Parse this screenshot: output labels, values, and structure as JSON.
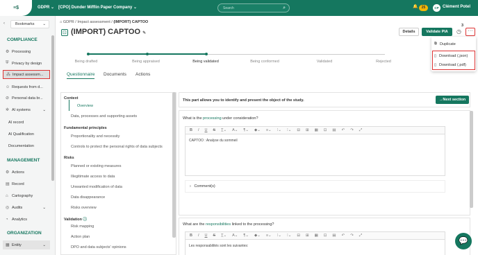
{
  "topbar": {
    "logo": "≡$",
    "app": "GDPR",
    "org": "[CPO] Dunder Mifflin Paper Company",
    "search_placeholder": "Search",
    "badge": "25",
    "avatar": "CP",
    "user": "Clément Potel"
  },
  "sidebar": {
    "bookmarks": "Bookmarks",
    "compliance": "COMPLIANCE",
    "items": [
      "Processing",
      "Privacy by design",
      "Impact assessm...",
      "Requests from d...",
      "Personal data br...",
      "AI systems",
      "AI record",
      "AI Qualification",
      "Documentation"
    ],
    "management": "MANAGEMENT",
    "mgmt_items": [
      "Actions",
      "Record",
      "Cartography",
      "Audits",
      "Analytics"
    ],
    "organization": "ORGANIZATION",
    "org_items": [
      "Entity"
    ]
  },
  "breadcrumb": {
    "home": "GDPR",
    "mid": "Impact assessment",
    "current": "(IMPORT) CAPTOO"
  },
  "title": "(IMPORT) CAPTOO",
  "buttons": {
    "details": "Details",
    "validate": "Validate PIA",
    "more": "···",
    "annotation": "3"
  },
  "dropdown": {
    "duplicate": "Duplicate",
    "json": "Download (.json)",
    "pdf": "Download (.pdf)"
  },
  "steps": [
    "Being drafted",
    "Being appraised",
    "Being validated",
    "Being conformed",
    "Validated",
    "Rejected"
  ],
  "tabs": [
    "Questionnaire",
    "Documents",
    "Actions"
  ],
  "nav": {
    "context": "Context",
    "overview": "Overview",
    "data_proc": "Data, processes and supporting assets",
    "fundamental": "Fundamental principles",
    "proportionality": "Proportionality and necessity",
    "controls": "Controls to protect the personal rights of data subjects",
    "risks": "Risks",
    "planned": "Planned or existing measures",
    "illegit": "Illegitimate access to data",
    "unwanted": "Unwanted modification of data",
    "disappear": "Data disappearance",
    "risks_overview": "Risks overview",
    "validation": "Validation",
    "risk_mapping": "Risk mapping",
    "action_plan": "Action plan",
    "dpo": "DPO and data subjects' opinions"
  },
  "content": {
    "intro": "This part allows you to identify and present the object of the study.",
    "next": "→Next section",
    "q1_pre": "What is the ",
    "q1_hl": "processing",
    "q1_post": " under consideration?",
    "q1_answer": "CAPTOO : Analyse du sommeil",
    "comments": "Comment(s)",
    "q2_pre": "What are the ",
    "q2_hl": "responsibilities",
    "q2_post": " linked to the processing?",
    "q2_answer": "Les responsabilités sont les suivantes:"
  }
}
